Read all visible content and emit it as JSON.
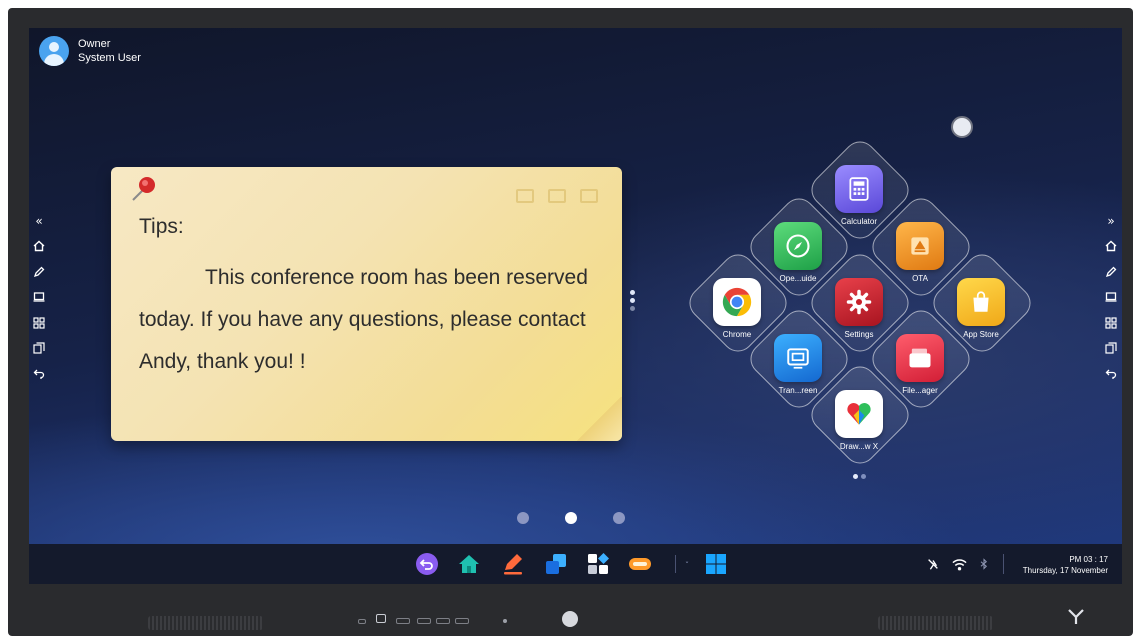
{
  "user": {
    "name": "Owner",
    "role": "System User"
  },
  "note": {
    "title": "Tips:",
    "body": "This conference room has been reserved today. If you have any questions, please contact Andy, thank you! !"
  },
  "apps": [
    {
      "label": "Calculator",
      "icon": "calculator-icon",
      "color": "#7c6cf0"
    },
    {
      "label": "Ope...uide",
      "icon": "compass-icon",
      "color": "#2fbf5b"
    },
    {
      "label": "OTA",
      "icon": "ota-icon",
      "color": "#f0a020"
    },
    {
      "label": "Chrome",
      "icon": "chrome-icon",
      "color": "#ffffff"
    },
    {
      "label": "Settings",
      "icon": "gear-icon",
      "color": "#c8202a"
    },
    {
      "label": "App Store",
      "icon": "app-store-icon",
      "color": "#f5c21a"
    },
    {
      "label": "Tran...reen",
      "icon": "transcreen-icon",
      "color": "#1a8ae8"
    },
    {
      "label": "File...ager",
      "icon": "file-manager-icon",
      "color": "#e83a4c"
    },
    {
      "label": "Draw...w X",
      "icon": "draw-icon",
      "color": "#ffffff"
    }
  ],
  "side_toolbar": [
    "collapse-icon",
    "home-icon",
    "pen-icon",
    "screen-icon",
    "apps-icon",
    "windows-icon",
    "back-icon"
  ],
  "pager": {
    "pages": 3,
    "current": 2
  },
  "taskbar": {
    "dock": [
      "back-icon",
      "home-icon",
      "annotate-icon",
      "window-icon",
      "apps-icon",
      "toolbox-icon",
      "windows-logo-icon"
    ],
    "clock_time": "PM 03 : 17",
    "clock_date": "Thursday, 17 November"
  },
  "colors": {
    "accent": "#1a8ae8",
    "screen_bg": "#162248",
    "note_bg": "#f4e3b3"
  }
}
